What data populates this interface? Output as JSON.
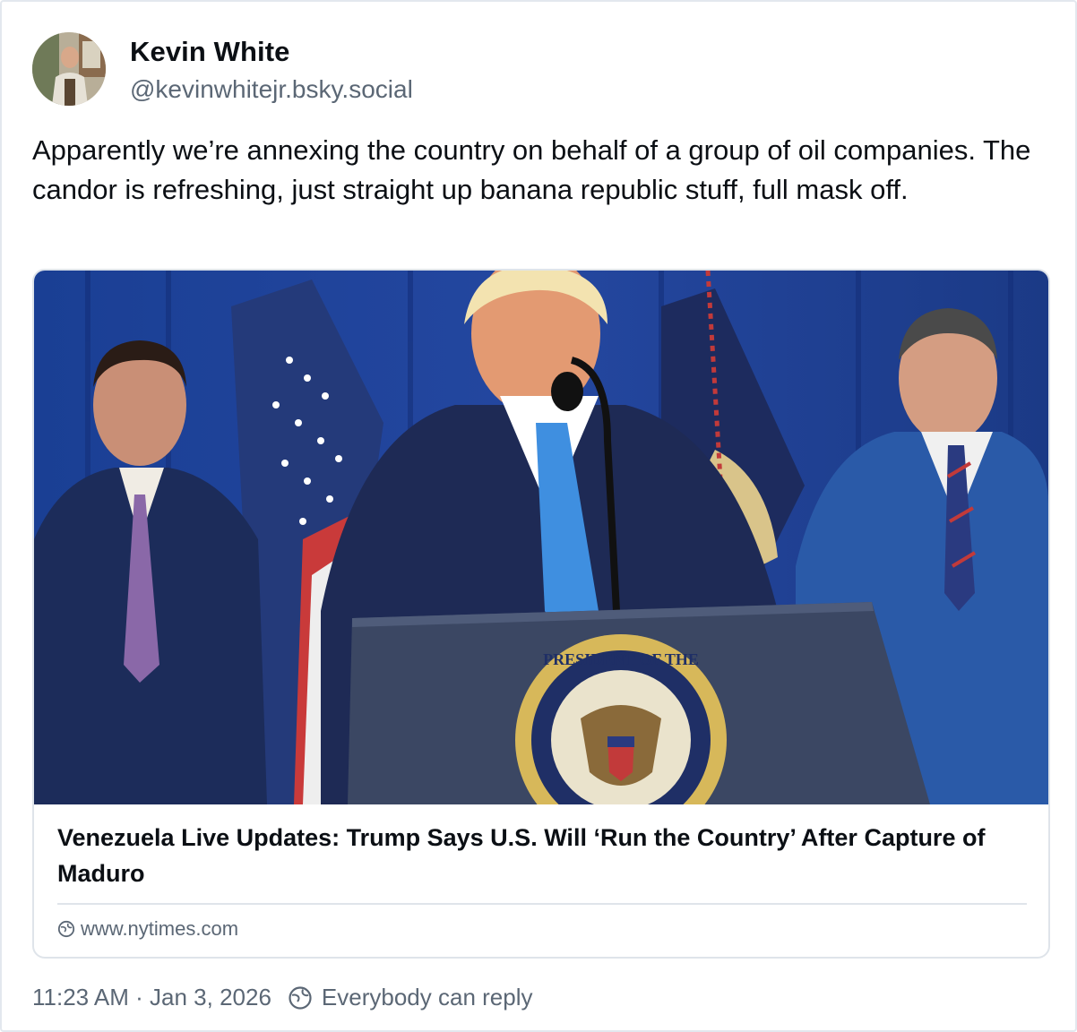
{
  "post": {
    "author": {
      "display_name": "Kevin White",
      "handle": "@kevinwhitejr.bsky.social"
    },
    "text": "Apparently we’re annexing the country on behalf of a group of oil companies. The candor is refreshing, just straight up banana republic stuff, full mask off.",
    "embed": {
      "title": "Venezuela Live Updates: Trump Says U.S. Will ‘Run the Country’ After Capture of Maduro",
      "domain": "www.nytimes.com",
      "image_seal_text": "PRESIDENT OF THE UNITED STATES"
    },
    "timestamp": "11:23 AM · Jan 3, 2026",
    "reply_setting": "Everybody can reply"
  },
  "icons": {
    "globe": "globe-icon",
    "reply_permission": "globe-icon"
  },
  "colors": {
    "text_primary": "#0b0f14",
    "text_secondary": "#5b6775",
    "border": "#dfe4ea",
    "curtain": "#1f3f8f"
  }
}
